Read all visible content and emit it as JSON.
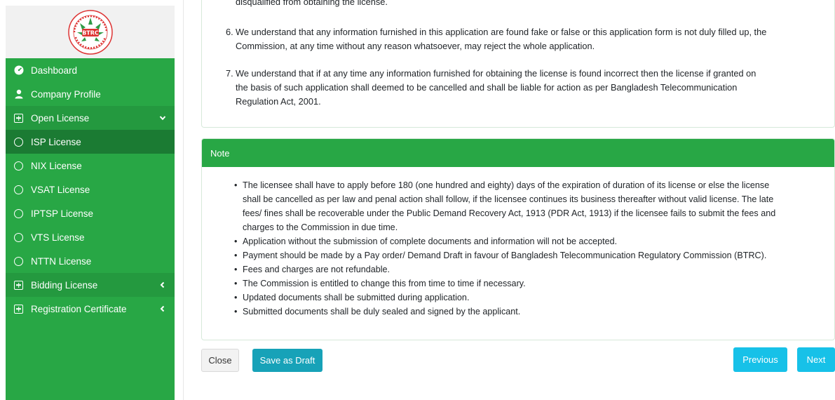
{
  "sidebar": {
    "logo_text": "BTRC",
    "items": [
      {
        "label": "Dashboard",
        "icon": "dashboard-icon"
      },
      {
        "label": "Company Profile",
        "icon": "user-icon"
      },
      {
        "label": "Open License",
        "icon": "plus-square-icon",
        "caret": "chevron-down-icon"
      },
      {
        "label": "ISP License",
        "icon": "circle-icon"
      },
      {
        "label": "NIX License",
        "icon": "circle-icon"
      },
      {
        "label": "VSAT License",
        "icon": "circle-icon"
      },
      {
        "label": "IPTSP License",
        "icon": "circle-icon"
      },
      {
        "label": "VTS License",
        "icon": "circle-icon"
      },
      {
        "label": "NTTN License",
        "icon": "circle-icon"
      },
      {
        "label": "Bidding License",
        "icon": "plus-square-icon",
        "caret": "chevron-left-icon"
      },
      {
        "label": "Registration Certificate",
        "icon": "plus-square-icon",
        "caret": "chevron-left-icon"
      }
    ]
  },
  "declarations": {
    "clipped_line": "disqualified from obtaining the license.",
    "item6_num": "6.",
    "item6_line1": "We understand that any information furnished in this application are found fake or false or this application form is not duly filled up, the",
    "item6_line2": "Commission, at any time without any reason whatsoever, may reject the whole application.",
    "item7_num": "7.",
    "item7_line1": "We understand that if at any time any information furnished for obtaining the license is found incorrect then the license if granted on",
    "item7_line2": "the basis of such application shall deemed to be cancelled and shall be liable for action as per Bangladesh Telecommunication",
    "item7_line3": "Regulation Act, 2001."
  },
  "note": {
    "title": "Note",
    "b1_l1": "The licensee shall have to apply before 180 (one hundred and eighty) days of the expiration of duration of its license or else the license",
    "b1_l2": "shall be cancelled as per law and penal action shall follow, if the licensee continues its business thereafter without valid license. The late",
    "b1_l3": "fees/ fines shall be recoverable under the Public Demand Recovery Act, 1913 (PDR Act, 1913) if the licensee fails to submit the fees and",
    "b1_l4": "charges to the Commission in due time.",
    "b2": "Application without the submission of complete documents and information will not be accepted.",
    "b3": "Payment should be made by a Pay order/ Demand Draft in favour of Bangladesh Telecommunication Regulatory Commission (BTRC).",
    "b4": "Fees and charges are not refundable.",
    "b5": "The Commission is entitled to change this from time to time if necessary.",
    "b6": "Updated documents shall be submitted during application.",
    "b7": "Submitted documents shall be duly sealed and signed by the applicant."
  },
  "buttons": {
    "close": "Close",
    "save_draft": "Save as Draft",
    "previous": "Previous",
    "next": "Next"
  },
  "colors": {
    "sidebar": "#28a745",
    "sidebar_active": "#1b7b33",
    "note_header": "#28a745",
    "info_button": "#17c1e8"
  }
}
